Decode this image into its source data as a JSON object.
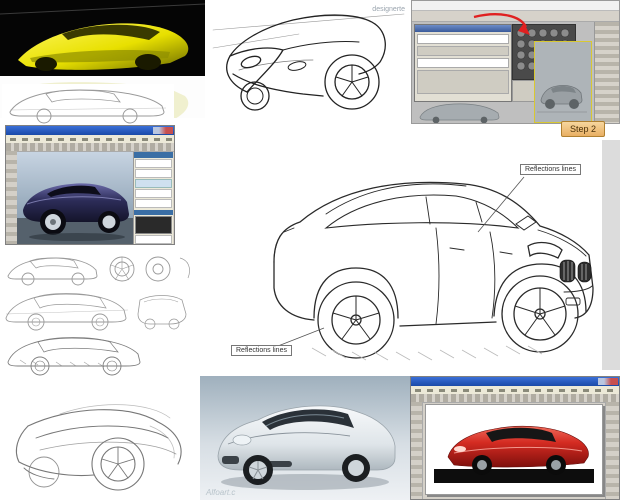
{
  "labels": {
    "step2": "Step 2",
    "reflections_top": "Reflections lines",
    "reflections_bottom": "Reflections lines"
  },
  "watermarks": {
    "designer": "designerte",
    "alfoart": "Alfoart.c"
  },
  "colors": {
    "concept_yellow": "#e8e000",
    "step2_bg": "#eeb969",
    "step2_border": "#b08030",
    "callout_border": "#777777",
    "ps_titlebar_blue": "#2a5bbf",
    "max_ui_gray": "#bfbfbf",
    "max_active_viewport_border": "#d8c832",
    "muscle_car_purple": "#3c3c6e",
    "red_car": "#cc2222",
    "silver_car": "#dfe5e9",
    "sketch_ink": "#222222",
    "pencil_gray": "#9a9a9a"
  }
}
